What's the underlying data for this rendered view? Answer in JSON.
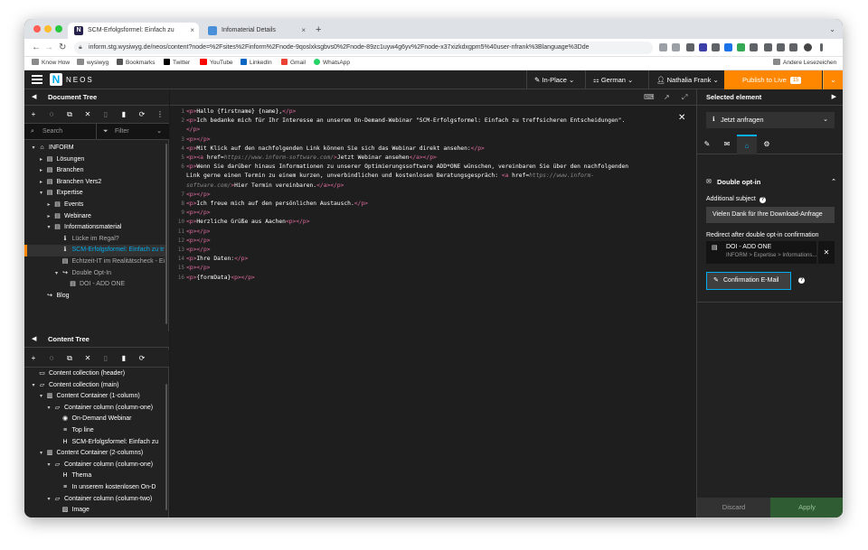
{
  "browser": {
    "tabs": [
      {
        "title": "SCM-Erfolgsformel: Einfach zu",
        "favicon": "neos-favicon"
      },
      {
        "title": "Infomaterial Details",
        "favicon": "page-favicon"
      }
    ],
    "url": "inform.stg.wysiwyg.de/neos/content?node=%2Fsites%2Finform%2Fnode-9qoslxksgbvs0%2Fnode-89zc1uyw4g6yv%2Fnode-x37xizkdxgpm5%40user-nfrank%3Blanguage%3Dde",
    "bookmarks": [
      "Know How",
      "wysiwyg",
      "Bookmarks",
      "Twitter",
      "YouTube",
      "LinkedIn",
      "Gmail",
      "WhatsApp"
    ],
    "other_bookmarks": "Andere Lesezeichen"
  },
  "neos": {
    "logo_text": "NEOS",
    "edit_mode": "In-Place",
    "language": "German",
    "user": "Nathalia Frank",
    "publish_label": "Publish to Live",
    "publish_count": "15"
  },
  "document_tree": {
    "title": "Document Tree",
    "search_placeholder": "Search",
    "filter_label": "Filter",
    "rows": [
      {
        "label": "INFORM",
        "depth": 0,
        "icon": "home-icon",
        "toggle": "▾",
        "state": "normal"
      },
      {
        "label": "Lösungen",
        "depth": 1,
        "icon": "page-icon",
        "toggle": "▸",
        "state": "normal"
      },
      {
        "label": "Branchen",
        "depth": 1,
        "icon": "page-icon",
        "toggle": "▸",
        "state": "normal"
      },
      {
        "label": "Branchen Vers2",
        "depth": 1,
        "icon": "page-icon",
        "toggle": "▸",
        "state": "normal"
      },
      {
        "label": "Expertise",
        "depth": 1,
        "icon": "page-icon",
        "toggle": "▾",
        "state": "normal"
      },
      {
        "label": "Events",
        "depth": 2,
        "icon": "page-icon",
        "toggle": "▸",
        "state": "normal"
      },
      {
        "label": "Webinare",
        "depth": 2,
        "icon": "page-icon",
        "toggle": "▸",
        "state": "normal"
      },
      {
        "label": "Informationsmaterial",
        "depth": 2,
        "icon": "page-icon",
        "toggle": "▾",
        "state": "normal"
      },
      {
        "label": "Lücke im Regal?",
        "depth": 3,
        "icon": "info-icon",
        "toggle": "",
        "state": "muted"
      },
      {
        "label": "SCM-Erfolgsformel: Einfach zu tr",
        "depth": 3,
        "icon": "info-icon",
        "toggle": "",
        "state": "active"
      },
      {
        "label": "Echtzeit-IT im Realitätscheck - Ei",
        "depth": 3,
        "icon": "page-icon",
        "toggle": "",
        "state": "muted"
      },
      {
        "label": "Double Opt-In",
        "depth": 3,
        "icon": "share-icon",
        "toggle": "▾",
        "state": "muted"
      },
      {
        "label": "DOI - ADD ONE",
        "depth": 4,
        "icon": "page-icon",
        "toggle": "",
        "state": "muted"
      },
      {
        "label": "Blog",
        "depth": 1,
        "icon": "share-icon",
        "toggle": "",
        "state": "normal"
      }
    ]
  },
  "content_tree": {
    "title": "Content Tree",
    "rows": [
      {
        "label": "Content collection (header)",
        "depth": 0,
        "icon": "folder-icon",
        "toggle": "",
        "state": "normal"
      },
      {
        "label": "Content collection (main)",
        "depth": 0,
        "icon": "folder-open-icon",
        "toggle": "▾",
        "state": "normal"
      },
      {
        "label": "Content Container (1-column)",
        "depth": 1,
        "icon": "columns-icon",
        "toggle": "▾",
        "state": "normal"
      },
      {
        "label": "Container column (column-one)",
        "depth": 2,
        "icon": "folder-open-icon",
        "toggle": "▾",
        "state": "normal"
      },
      {
        "label": "On-Demand Webinar",
        "depth": 3,
        "icon": "eye-icon",
        "toggle": "",
        "state": "normal"
      },
      {
        "label": "Top line",
        "depth": 3,
        "icon": "text-icon",
        "toggle": "",
        "state": "normal"
      },
      {
        "label": "SCM-Erfolgsformel: Einfach zu",
        "depth": 3,
        "icon": "heading-icon",
        "toggle": "",
        "state": "normal"
      },
      {
        "label": "Content Container (2-columns)",
        "depth": 1,
        "icon": "columns-icon",
        "toggle": "▾",
        "state": "normal"
      },
      {
        "label": "Container column (column-one)",
        "depth": 2,
        "icon": "folder-open-icon",
        "toggle": "▾",
        "state": "normal"
      },
      {
        "label": "Thema",
        "depth": 3,
        "icon": "heading-icon",
        "toggle": "",
        "state": "normal"
      },
      {
        "label": "In unserem kostenlosen On-D",
        "depth": 3,
        "icon": "text-icon",
        "toggle": "",
        "state": "normal"
      },
      {
        "label": "Container column (column-two)",
        "depth": 2,
        "icon": "folder-open-icon",
        "toggle": "▾",
        "state": "normal"
      },
      {
        "label": "Image",
        "depth": 3,
        "icon": "image-icon",
        "toggle": "",
        "state": "normal"
      },
      {
        "label": "Jetzt anfragen",
        "depth": 1,
        "icon": "info-icon",
        "toggle": "",
        "state": "blue"
      }
    ]
  },
  "editor": {
    "lines": [
      [
        [
          "tg",
          "<p>"
        ],
        [
          "tx",
          "Hallo {firstname} {name},"
        ],
        [
          "tg",
          "</p>"
        ]
      ],
      [
        [
          "tg",
          "<p>"
        ],
        [
          "tx",
          "Ich bedanke mich für Ihr Interesse an unserem On-Demand-Webinar \"SCM-Erfolgsformel: Einfach zu treffsicheren Entscheidungen\"."
        ]
      ],
      [
        [
          "tg",
          "</p>"
        ]
      ],
      [
        [
          "tg",
          "<p></p>"
        ]
      ],
      [
        [
          "tg",
          "<p>"
        ],
        [
          "tx",
          "Mit Klick auf den nachfolgenden Link können Sie sich das Webinar direkt ansehen:"
        ],
        [
          "tg",
          "</p>"
        ]
      ],
      [
        [
          "tg",
          "<p><a "
        ],
        [
          "at",
          "href="
        ],
        [
          "url",
          "https://www.inform-software.com/"
        ],
        [
          "tg",
          ">"
        ],
        [
          "tx",
          "Jetzt Webinar ansehen"
        ],
        [
          "tg",
          "</a></p>"
        ]
      ],
      [
        [
          "tg",
          "<p>"
        ],
        [
          "tx",
          "Wenn Sie darüber hinaus Informationen zu unserer Optimierungssoftware ADD*ONE wünschen, vereinbaren Sie über den nachfolgenden"
        ]
      ],
      [
        [
          "tx",
          "Link gerne einen Termin zu einem kurzen, unverbindlichen und kostenlosen Beratungsgespräch: "
        ],
        [
          "tg",
          "<a "
        ],
        [
          "at",
          "href="
        ],
        [
          "url",
          "https://www.inform-"
        ]
      ],
      [
        [
          "url",
          "software.com/"
        ],
        [
          "tg",
          ">"
        ],
        [
          "tx",
          "Hier Termin vereinbaren."
        ],
        [
          "tg",
          "</a></p>"
        ]
      ],
      [
        [
          "tg",
          "<p></p>"
        ]
      ],
      [
        [
          "tg",
          "<p>"
        ],
        [
          "tx",
          "Ich freue mich auf den persönlichen Austausch."
        ],
        [
          "tg",
          "</p>"
        ]
      ],
      [
        [
          "tg",
          "<p></p>"
        ]
      ],
      [
        [
          "tg",
          "<p>"
        ],
        [
          "tx",
          "Herzliche Grüße aus Aachen"
        ],
        [
          "tg",
          "<p></p>"
        ]
      ],
      [
        [
          "tg",
          "<p></p>"
        ]
      ],
      [
        [
          "tg",
          "<p></p>"
        ]
      ],
      [
        [
          "tg",
          "<p></p>"
        ]
      ],
      [
        [
          "tg",
          "<p>"
        ],
        [
          "tx",
          "Ihre Daten:"
        ],
        [
          "tg",
          "</p>"
        ]
      ],
      [
        [
          "tg",
          "<p></p>"
        ]
      ],
      [
        [
          "tg",
          "<p>"
        ],
        [
          "tx",
          "{formData}"
        ],
        [
          "tg",
          "<p></p>"
        ]
      ]
    ],
    "line_numbers": [
      "1",
      "2",
      "",
      "3",
      "4",
      "5",
      "6",
      "",
      "",
      "7",
      "8",
      "9",
      "10",
      "11",
      "12",
      "13",
      "14",
      "15",
      "16"
    ]
  },
  "inspector": {
    "title": "Selected element",
    "selected": "Jetzt anfragen",
    "section": "Double opt-in",
    "subject_label": "Additional subject",
    "subject_value": "Vielen Dank für Ihre Download-Anfrage",
    "redirect_label": "Redirect after double opt-in confirmation",
    "redirect_title": "DOI - ADD ONE",
    "redirect_path": "INFORM > Expertise > Informations...",
    "confirm_button": "Confirmation E-Mail",
    "discard": "Discard",
    "apply": "Apply"
  },
  "colors": {
    "neos_accent": "#00adee",
    "publish_orange": "#ff8700",
    "apply_green": "#2f5c33"
  }
}
